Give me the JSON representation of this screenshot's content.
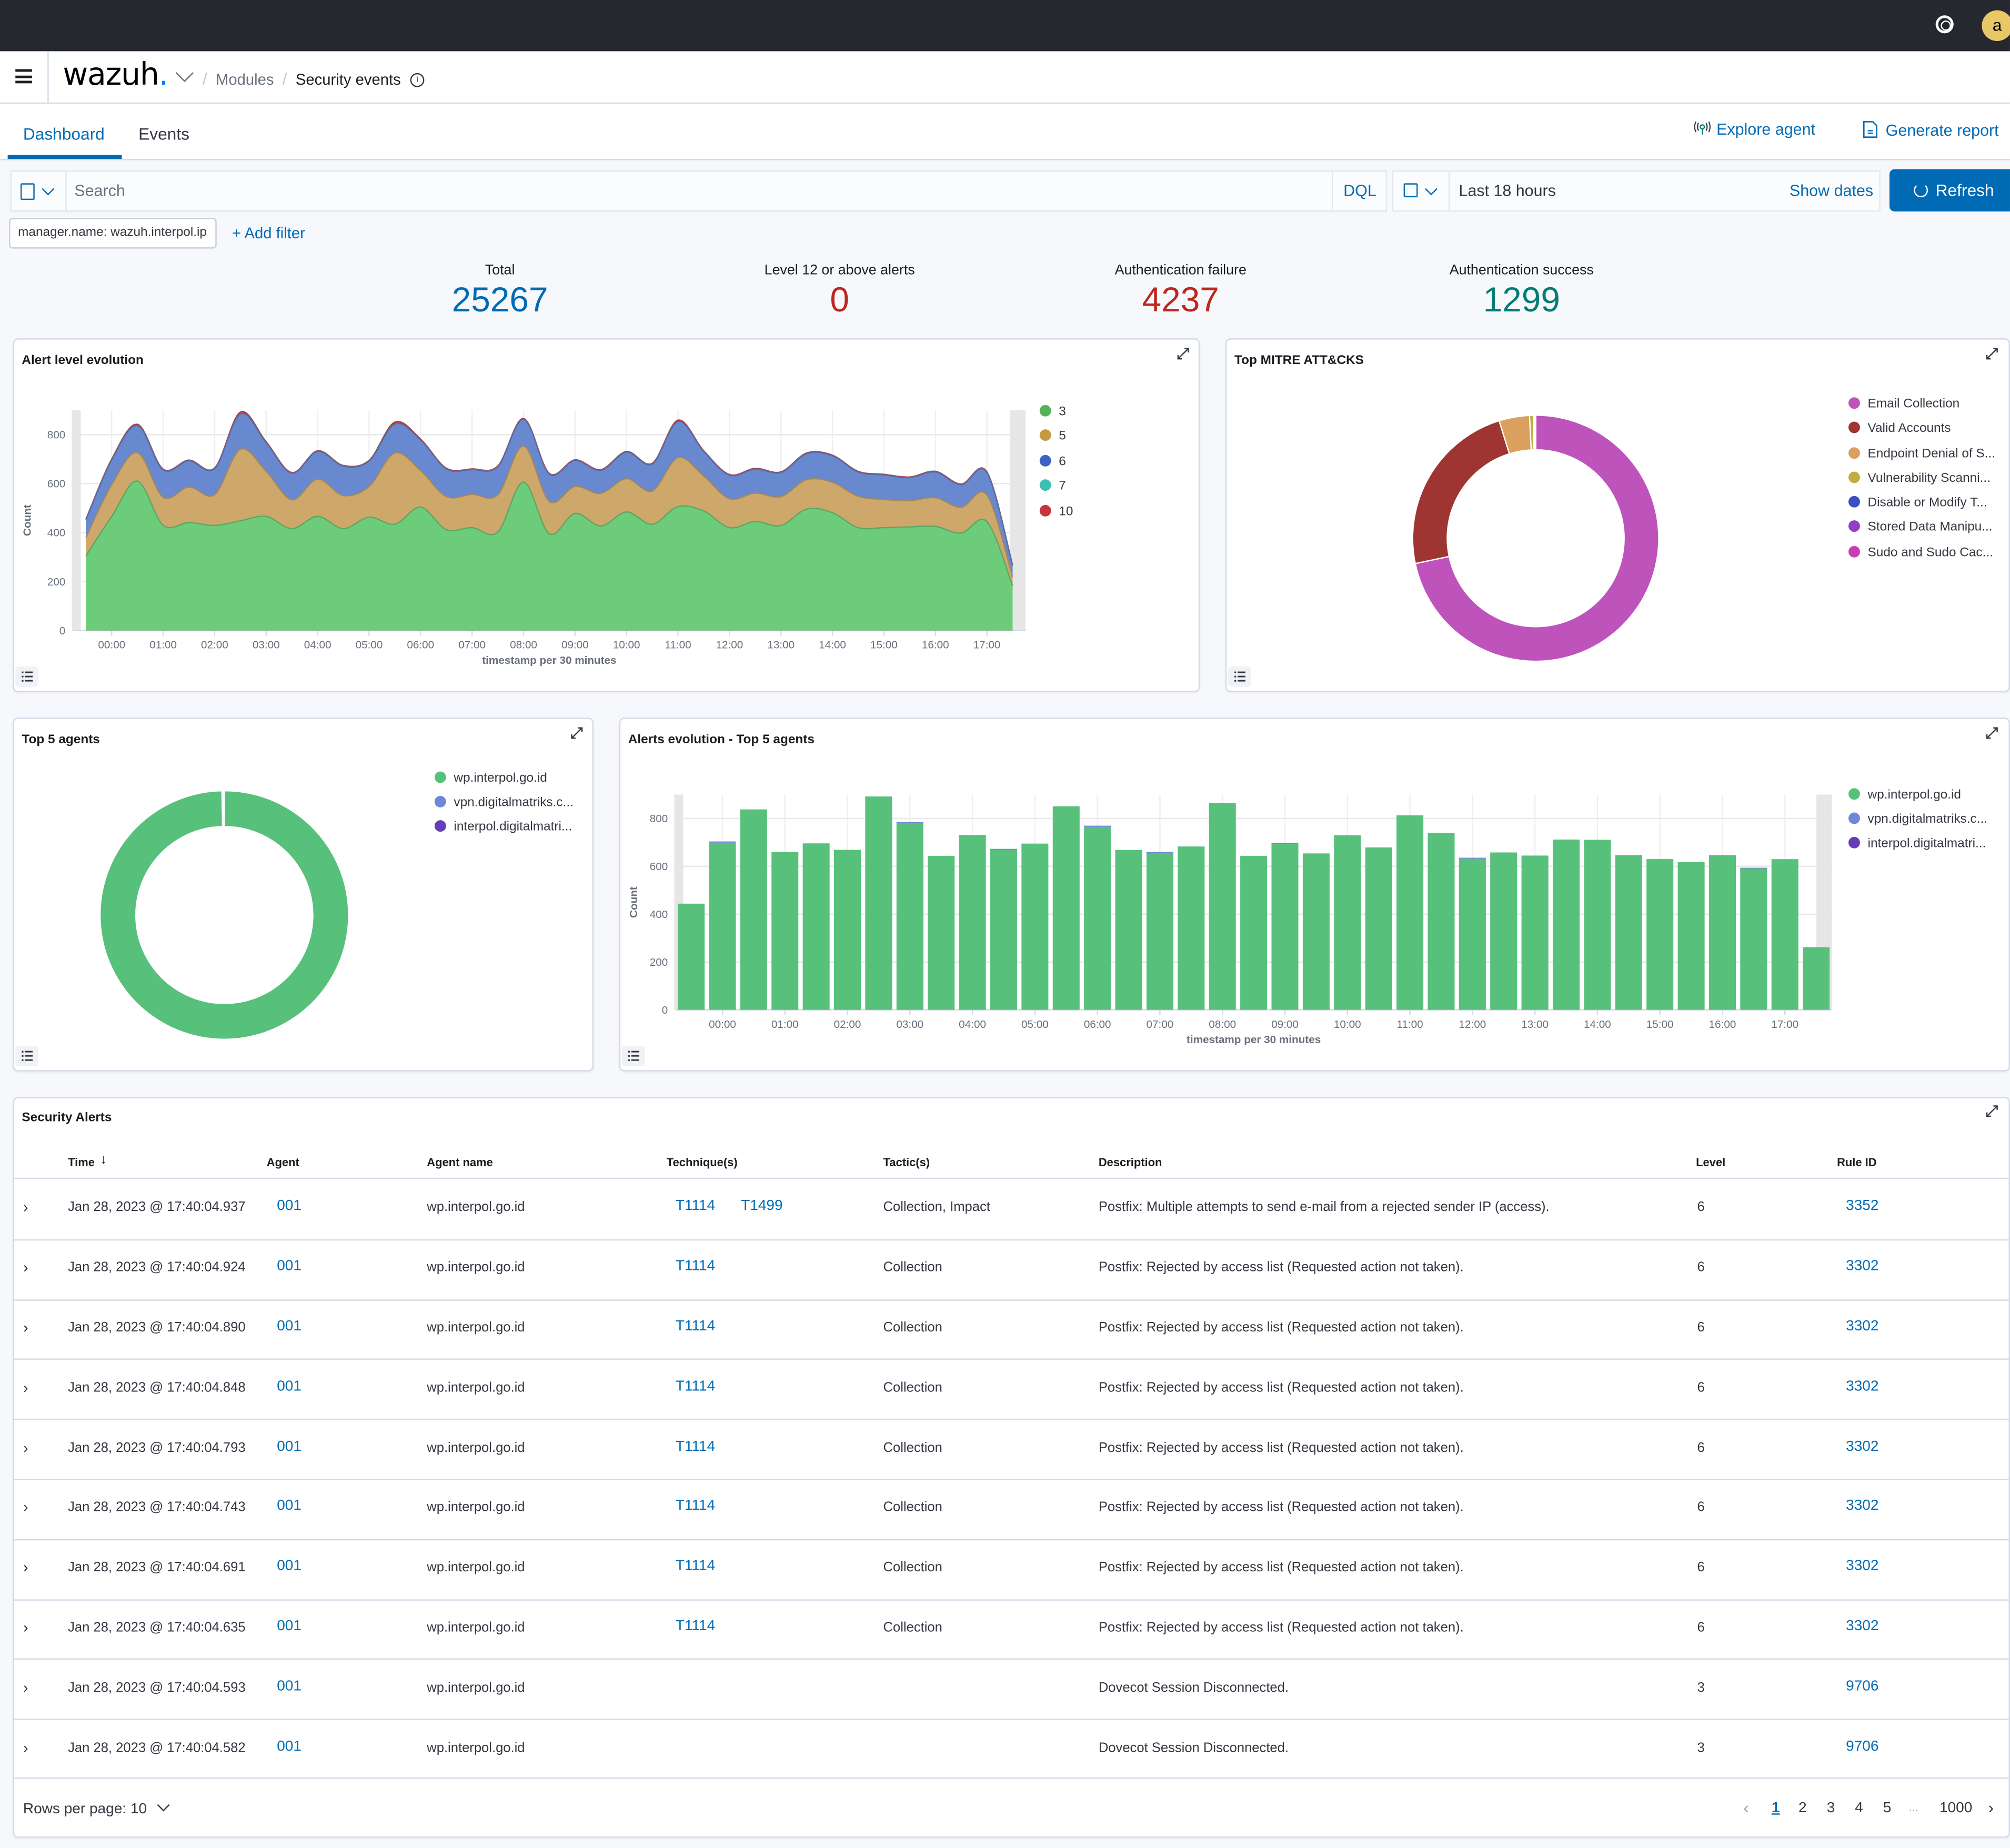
{
  "topbar": {
    "help_icon": "help-lifebuoy-icon",
    "avatar_initial": "a"
  },
  "header": {
    "logo": "wazuh",
    "logo_dot": ".",
    "breadcrumb": [
      "Modules",
      "Security events"
    ],
    "info_icon": "info-icon"
  },
  "tabs": [
    {
      "label": "Dashboard",
      "active": true
    },
    {
      "label": "Events",
      "active": false
    }
  ],
  "actions": {
    "explore_agent": "Explore agent",
    "generate_report": "Generate report"
  },
  "search": {
    "placeholder": "Search",
    "value": "",
    "language": "DQL",
    "date_range": "Last 18 hours",
    "show_dates": "Show dates",
    "refresh": "Refresh"
  },
  "filters": {
    "pills": [
      "manager.name: wazuh.interpol.ip"
    ],
    "add_filter": "+ Add filter"
  },
  "stats": [
    {
      "label": "Total",
      "value": "25267",
      "color": "#006bb4"
    },
    {
      "label": "Level 12 or above alerts",
      "value": "0",
      "color": "#bd271e"
    },
    {
      "label": "Authentication failure",
      "value": "4237",
      "color": "#bd271e"
    },
    {
      "label": "Authentication success",
      "value": "1299",
      "color": "#017d73"
    }
  ],
  "panels": {
    "alert_level": {
      "title": "Alert level evolution"
    },
    "mitre": {
      "title": "Top MITRE ATT&CKS"
    },
    "top_agents": {
      "title": "Top 5 agents"
    },
    "alerts_evolution": {
      "title": "Alerts evolution - Top 5 agents"
    },
    "security_alerts": {
      "title": "Security Alerts"
    }
  },
  "chart_data": [
    {
      "id": "alert_level_evolution",
      "type": "area",
      "stacked": true,
      "title": "Alert level evolution",
      "xlabel": "timestamp per 30 minutes",
      "ylabel": "Count",
      "ylim": [
        0,
        900
      ],
      "yticks": [
        0,
        200,
        400,
        600,
        800
      ],
      "xticks": [
        "00:00",
        "01:00",
        "02:00",
        "03:00",
        "04:00",
        "05:00",
        "06:00",
        "07:00",
        "08:00",
        "09:00",
        "10:00",
        "11:00",
        "12:00",
        "13:00",
        "14:00",
        "15:00",
        "16:00",
        "17:00"
      ],
      "x": [
        "23:30",
        "00:00",
        "00:30",
        "01:00",
        "01:30",
        "02:00",
        "02:30",
        "03:00",
        "03:30",
        "04:00",
        "04:30",
        "05:00",
        "05:30",
        "06:00",
        "06:30",
        "07:00",
        "07:30",
        "08:00",
        "08:30",
        "09:00",
        "09:30",
        "10:00",
        "10:30",
        "11:00",
        "11:30",
        "12:00",
        "12:30",
        "13:00",
        "13:30",
        "14:00",
        "14:30",
        "15:00",
        "15:30",
        "16:00",
        "16:30",
        "17:00",
        "17:30"
      ],
      "legend_position": "right",
      "series": [
        {
          "name": "3",
          "color": "#54b399",
          "fill": "#6dcc7a",
          "values": [
            305,
            466,
            610,
            430,
            441,
            429,
            448,
            466,
            416,
            466,
            416,
            463,
            434,
            504,
            412,
            420,
            402,
            606,
            395,
            478,
            427,
            484,
            434,
            506,
            488,
            420,
            445,
            429,
            496,
            481,
            420,
            420,
            423,
            425,
            398,
            445,
            183
          ]
        },
        {
          "name": "5",
          "color": "#d6bf57",
          "fill": "#cda86a",
          "values": [
            75,
            129,
            116,
            114,
            145,
            126,
            292,
            184,
            118,
            152,
            135,
            125,
            291,
            149,
            135,
            136,
            152,
            147,
            132,
            110,
            133,
            136,
            136,
            200,
            143,
            118,
            116,
            118,
            120,
            124,
            128,
            115,
            107,
            117,
            105,
            108,
            36
          ]
        },
        {
          "name": "6",
          "color": "#6092c0",
          "fill": "#6889cf",
          "values": [
            72,
            101,
            111,
            112,
            107,
            106,
            144,
            117,
            108,
            113,
            120,
            104,
            118,
            125,
            113,
            101,
            115,
            109,
            112,
            106,
            94,
            108,
            110,
            147,
            100,
            96,
            98,
            98,
            106,
            108,
            99,
            100,
            94,
            105,
            92,
            92,
            46
          ]
        },
        {
          "name": "7",
          "color": "#41c0b4",
          "fill": "#41c0b4",
          "values": [
            0,
            0,
            0,
            0,
            0,
            0,
            0,
            0,
            0,
            0,
            0,
            0,
            0,
            0,
            0,
            0,
            0,
            0,
            0,
            0,
            0,
            0,
            0,
            0,
            0,
            0,
            0,
            0,
            0,
            0,
            0,
            0,
            0,
            0,
            0,
            0,
            0
          ]
        },
        {
          "name": "10",
          "color": "#c84549",
          "fill": "#c84549",
          "values": [
            3,
            4,
            5,
            3,
            3,
            3,
            8,
            4,
            3,
            3,
            3,
            3,
            8,
            4,
            3,
            3,
            3,
            4,
            3,
            3,
            3,
            3,
            3,
            6,
            3,
            3,
            3,
            3,
            3,
            3,
            3,
            3,
            3,
            3,
            3,
            3,
            2
          ]
        }
      ]
    },
    {
      "id": "top_mitre",
      "type": "pie",
      "donut": true,
      "title": "Top MITRE ATT&CKS",
      "legend_position": "right",
      "labels": [
        "Email Collection",
        "Valid Accounts",
        "Endpoint Denial of S...",
        "Vulnerability Scanni...",
        "Disable or Modify T...",
        "Stored Data Manipu...",
        "Sudo and Sudo Cac..."
      ],
      "values": [
        71.7,
        23.5,
        4.0,
        0.5,
        0.1,
        0.1,
        0.1
      ],
      "colors": [
        "#be53bc",
        "#9e3533",
        "#daa05d",
        "#bfaf41",
        "#3b4ec4",
        "#8f3fc8",
        "#c73fb4"
      ]
    },
    {
      "id": "top_5_agents",
      "type": "pie",
      "donut": true,
      "title": "Top 5 agents",
      "legend_position": "right",
      "labels": [
        "wp.interpol.go.id",
        "vpn.digitalmatriks.c...",
        "interpol.digitalmatri..."
      ],
      "values": [
        99.7,
        0.2,
        0.1
      ],
      "colors": [
        "#57c17b",
        "#6f87d8",
        "#663db8"
      ]
    },
    {
      "id": "alerts_evolution_top5",
      "type": "bar",
      "stacked": true,
      "title": "Alerts evolution - Top 5 agents",
      "xlabel": "timestamp per 30 minutes",
      "ylabel": "Count",
      "ylim": [
        0,
        900
      ],
      "yticks": [
        0,
        200,
        400,
        600,
        800
      ],
      "xticks": [
        "00:00",
        "01:00",
        "02:00",
        "03:00",
        "04:00",
        "05:00",
        "06:00",
        "07:00",
        "08:00",
        "09:00",
        "10:00",
        "11:00",
        "12:00",
        "13:00",
        "14:00",
        "15:00",
        "16:00",
        "17:00"
      ],
      "x": [
        "23:30",
        "00:00",
        "00:30",
        "01:00",
        "01:30",
        "02:00",
        "02:30",
        "03:00",
        "03:30",
        "04:00",
        "04:30",
        "05:00",
        "05:30",
        "06:00",
        "06:30",
        "07:00",
        "07:30",
        "08:00",
        "08:30",
        "09:00",
        "09:30",
        "10:00",
        "10:30",
        "11:00",
        "11:30",
        "12:00",
        "12:30",
        "13:00",
        "13:30",
        "14:00",
        "14:30",
        "15:00",
        "15:30",
        "16:00",
        "16:30",
        "17:00",
        "17:30"
      ],
      "legend_position": "right",
      "series": [
        {
          "name": "wp.interpol.go.id",
          "color": "#57c17b",
          "values": [
            444,
            699,
            838,
            660,
            696,
            669,
            892,
            781,
            644,
            731,
            672,
            695,
            851,
            765,
            668,
            659,
            683,
            865,
            644,
            694,
            654,
            730,
            679,
            813,
            740,
            632,
            658,
            645,
            712,
            711,
            647,
            627,
            618,
            647,
            593,
            630,
            262
          ]
        },
        {
          "name": "vpn.digitalmatriks.c...",
          "color": "#6f87d8",
          "values": [
            0,
            5,
            0,
            0,
            0,
            0,
            0,
            4,
            0,
            0,
            1,
            0,
            0,
            5,
            0,
            1,
            0,
            0,
            0,
            3,
            0,
            0,
            0,
            0,
            0,
            4,
            0,
            0,
            0,
            0,
            0,
            3,
            0,
            0,
            1,
            0,
            0
          ]
        },
        {
          "name": "interpol.digitalmatri...",
          "color": "#663db8",
          "values": [
            0,
            0,
            0,
            0,
            0,
            0,
            0,
            0,
            0,
            0,
            0,
            0,
            0,
            0,
            0,
            0,
            0,
            0,
            0,
            0,
            0,
            0,
            0,
            0,
            0,
            0,
            0,
            0,
            0,
            0,
            0,
            0,
            0,
            0,
            0,
            0,
            0
          ]
        }
      ]
    }
  ],
  "table": {
    "columns": [
      "Time",
      "Agent",
      "Agent name",
      "Technique(s)",
      "Tactic(s)",
      "Description",
      "Level",
      "Rule ID"
    ],
    "sort_icon": "arrow-down-icon",
    "rows": [
      {
        "time": "Jan 28, 2023 @ 17:40:04.937",
        "agent": "001",
        "agent_name": "wp.interpol.go.id",
        "techniques": [
          "T1114",
          "T1499"
        ],
        "tactics": "Collection, Impact",
        "description": "Postfix: Multiple attempts to send e-mail from a rejected sender IP (access).",
        "level": "6",
        "rule_id": "3352"
      },
      {
        "time": "Jan 28, 2023 @ 17:40:04.924",
        "agent": "001",
        "agent_name": "wp.interpol.go.id",
        "techniques": [
          "T1114"
        ],
        "tactics": "Collection",
        "description": "Postfix: Rejected by access list (Requested action not taken).",
        "level": "6",
        "rule_id": "3302"
      },
      {
        "time": "Jan 28, 2023 @ 17:40:04.890",
        "agent": "001",
        "agent_name": "wp.interpol.go.id",
        "techniques": [
          "T1114"
        ],
        "tactics": "Collection",
        "description": "Postfix: Rejected by access list (Requested action not taken).",
        "level": "6",
        "rule_id": "3302"
      },
      {
        "time": "Jan 28, 2023 @ 17:40:04.848",
        "agent": "001",
        "agent_name": "wp.interpol.go.id",
        "techniques": [
          "T1114"
        ],
        "tactics": "Collection",
        "description": "Postfix: Rejected by access list (Requested action not taken).",
        "level": "6",
        "rule_id": "3302"
      },
      {
        "time": "Jan 28, 2023 @ 17:40:04.793",
        "agent": "001",
        "agent_name": "wp.interpol.go.id",
        "techniques": [
          "T1114"
        ],
        "tactics": "Collection",
        "description": "Postfix: Rejected by access list (Requested action not taken).",
        "level": "6",
        "rule_id": "3302"
      },
      {
        "time": "Jan 28, 2023 @ 17:40:04.743",
        "agent": "001",
        "agent_name": "wp.interpol.go.id",
        "techniques": [
          "T1114"
        ],
        "tactics": "Collection",
        "description": "Postfix: Rejected by access list (Requested action not taken).",
        "level": "6",
        "rule_id": "3302"
      },
      {
        "time": "Jan 28, 2023 @ 17:40:04.691",
        "agent": "001",
        "agent_name": "wp.interpol.go.id",
        "techniques": [
          "T1114"
        ],
        "tactics": "Collection",
        "description": "Postfix: Rejected by access list (Requested action not taken).",
        "level": "6",
        "rule_id": "3302"
      },
      {
        "time": "Jan 28, 2023 @ 17:40:04.635",
        "agent": "001",
        "agent_name": "wp.interpol.go.id",
        "techniques": [
          "T1114"
        ],
        "tactics": "Collection",
        "description": "Postfix: Rejected by access list (Requested action not taken).",
        "level": "6",
        "rule_id": "3302"
      },
      {
        "time": "Jan 28, 2023 @ 17:40:04.593",
        "agent": "001",
        "agent_name": "wp.interpol.go.id",
        "techniques": [],
        "tactics": "",
        "description": "Dovecot Session Disconnected.",
        "level": "3",
        "rule_id": "9706"
      },
      {
        "time": "Jan 28, 2023 @ 17:40:04.582",
        "agent": "001",
        "agent_name": "wp.interpol.go.id",
        "techniques": [],
        "tactics": "",
        "description": "Dovecot Session Disconnected.",
        "level": "3",
        "rule_id": "9706"
      }
    ],
    "rows_per_page_label": "Rows per page: 10",
    "pagination": {
      "pages": [
        "1",
        "2",
        "3",
        "4",
        "5"
      ],
      "ellipsis": "...",
      "last": "1000",
      "current": "1"
    }
  }
}
